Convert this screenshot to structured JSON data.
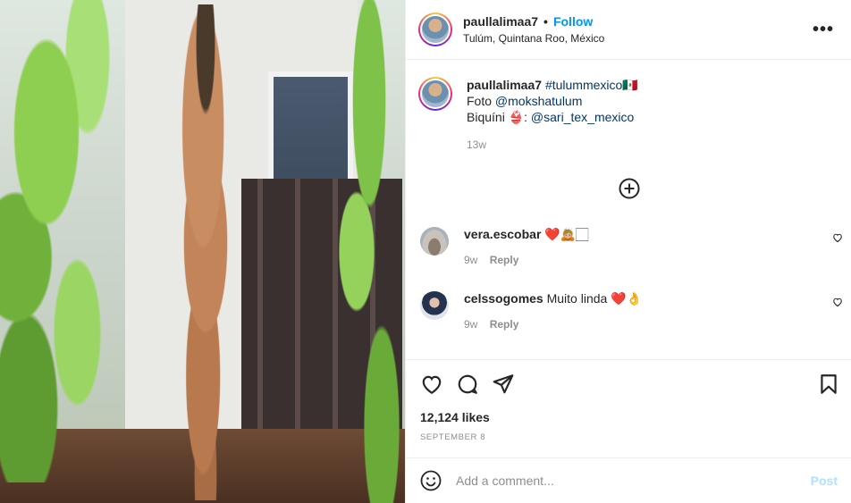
{
  "header": {
    "username": "paullalimaa7",
    "separator": "•",
    "follow_label": "Follow",
    "location": "Tulúm, Quintana Roo, México",
    "more_label": "•••"
  },
  "caption": {
    "username": "paullalimaa7",
    "hashtag": "#tulummexico🇲🇽",
    "line2_prefix": "Foto",
    "line2_mention": "@mokshatulum",
    "line3_prefix": "Biquíni 👙:",
    "line3_mention": "@sari_tex_mexico",
    "time": "13w"
  },
  "comments": [
    {
      "username": "vera.escobar",
      "text": "❤️🙇🏼🏻",
      "time": "9w",
      "reply_label": "Reply"
    },
    {
      "username": "celssogomes",
      "text": "Muito linda ❤️👌",
      "time": "9w",
      "reply_label": "Reply"
    }
  ],
  "actions": {
    "likes": "12,124 likes",
    "date": "SEPTEMBER 8"
  },
  "add_comment": {
    "placeholder": "Add a comment...",
    "post_label": "Post"
  },
  "icons": [
    "more-options-icon",
    "add-circle-icon",
    "heart-icon",
    "comment-icon",
    "share-icon",
    "bookmark-icon",
    "emoji-icon"
  ],
  "colors": {
    "accent": "#0095f6",
    "post_disabled": "#b2dffc",
    "link": "#00376b",
    "muted": "#8e8e8e"
  }
}
